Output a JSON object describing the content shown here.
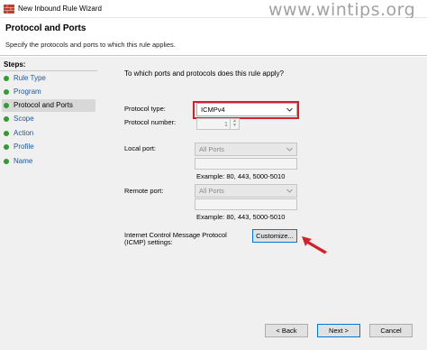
{
  "window": {
    "title": "New Inbound Rule Wizard",
    "watermark": "www.wintips.org"
  },
  "header": {
    "title": "Protocol and Ports",
    "subtitle": "Specify the protocols and ports to which this rule applies."
  },
  "steps": {
    "title": "Steps:",
    "items": [
      {
        "label": "Rule Type",
        "active": false
      },
      {
        "label": "Program",
        "active": false
      },
      {
        "label": "Protocol and Ports",
        "active": true
      },
      {
        "label": "Scope",
        "active": false
      },
      {
        "label": "Action",
        "active": false
      },
      {
        "label": "Profile",
        "active": false
      },
      {
        "label": "Name",
        "active": false
      }
    ]
  },
  "main": {
    "question": "To which ports and protocols does this rule apply?",
    "protocol_type": {
      "label": "Protocol type:",
      "value": "ICMPv4"
    },
    "protocol_number": {
      "label": "Protocol number:",
      "value": "1"
    },
    "local_port": {
      "label": "Local port:",
      "value": "All Ports",
      "example": "Example: 80, 443, 5000-5010"
    },
    "remote_port": {
      "label": "Remote port:",
      "value": "All Ports",
      "example": "Example: 80, 443, 5000-5010"
    },
    "icmp": {
      "label_line1": "Internet Control Message Protocol",
      "label_line2": "(ICMP) settings:",
      "button": "Customize..."
    }
  },
  "buttons": {
    "back": "< Back",
    "next": "Next >",
    "cancel": "Cancel"
  },
  "colors": {
    "highlight": "#d4202a",
    "step_dot": "#2f9e2f",
    "link": "#1e5aa0"
  }
}
